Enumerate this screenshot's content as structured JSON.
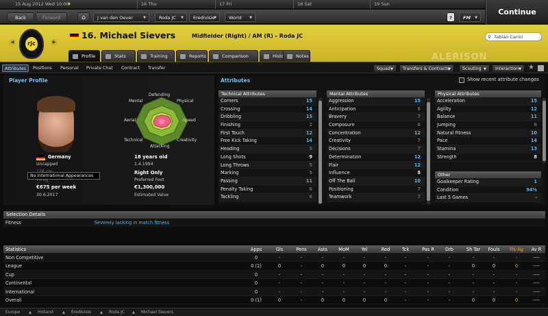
{
  "topbar": {
    "date": "15 Aug 2012 Wed 10:00",
    "days": [
      "16 Thu",
      "17 Fri",
      "18 Sat",
      "19 Sun"
    ]
  },
  "nav": {
    "back": "Back",
    "forward": "Forward",
    "manager": "J van den Oever",
    "club": "Roda JC",
    "league": "Eredivisie",
    "world": "World",
    "help": "?",
    "fm": "FM",
    "continue": "Continue"
  },
  "player": {
    "number_name": "16. Michael Sievers",
    "position_club": "Midfielder (Right) / AM (R) - Roda JC",
    "search_value": "fabián Carini",
    "crest_text": "rJc",
    "watermark": "ALERISON"
  },
  "player_tabs": [
    "Profile",
    "Stats",
    "Training",
    "Reports",
    "Comparison",
    "History",
    "Notes"
  ],
  "sub_tabs": [
    "Attributes",
    "Positions",
    "Personal",
    "Private Chat",
    "Contract",
    "Transfer"
  ],
  "sub_dropdowns": [
    "Squad",
    "Transfers & Contracts",
    "Scouting",
    "Interaction"
  ],
  "profile": {
    "title": "Player Profile",
    "nationality": "Germany",
    "caps": "Uncapped",
    "tooltip": "No International Appearances",
    "height": "178 cm",
    "weight": "76 kg",
    "wage": "€675 per week",
    "contract_end": "30.6.2017",
    "age": "18 years old",
    "dob": "1.4.1994",
    "foot": "Right Only",
    "foot_label": "Preferred Foot",
    "value": "€1,300,000",
    "value_label": "Estimated Value",
    "radar_labels": {
      "defending": "Defending",
      "physical": "Physical",
      "speed": "Speed",
      "creativity": "Creativity",
      "attacking": "Attacking",
      "technical": "Technical",
      "aerial": "Aerial",
      "mental": "Mental"
    }
  },
  "attributes": {
    "title": "Attributes",
    "show_recent": "Show recent attribute changes",
    "technical_title": "Technical Attributes",
    "technical": [
      [
        "Corners",
        "15"
      ],
      [
        "Crossing",
        "14"
      ],
      [
        "Dribbling",
        "15"
      ],
      [
        "Finishing",
        "2"
      ],
      [
        "First Touch",
        "12"
      ],
      [
        "Free Kick Taking",
        "14"
      ],
      [
        "Heading",
        "5"
      ],
      [
        "Long Shots",
        "9"
      ],
      [
        "Long Throws",
        "5"
      ],
      [
        "Marking",
        "5"
      ],
      [
        "Passing",
        "11"
      ],
      [
        "Penalty Taking",
        "6"
      ],
      [
        "Tackling",
        "6"
      ]
    ],
    "mental_title": "Mental Attributes",
    "mental": [
      [
        "Aggression",
        "15"
      ],
      [
        "Anticipation",
        "6"
      ],
      [
        "Bravery",
        "7"
      ],
      [
        "Composure",
        "6"
      ],
      [
        "Concentration",
        "12"
      ],
      [
        "Creativity",
        "7"
      ],
      [
        "Decisions",
        "7"
      ],
      [
        "Determination",
        "12"
      ],
      [
        "Flair",
        "12"
      ],
      [
        "Influence",
        "8"
      ],
      [
        "Off The Ball",
        "10"
      ],
      [
        "Positioning",
        "7"
      ],
      [
        "Teamwork",
        "7"
      ]
    ],
    "physical_title": "Physical Attributes",
    "physical": [
      [
        "Acceleration",
        "15"
      ],
      [
        "Agility",
        "12"
      ],
      [
        "Balance",
        "11"
      ],
      [
        "Jumping",
        "6"
      ],
      [
        "Natural Fitness",
        "10"
      ],
      [
        "Pace",
        "14"
      ],
      [
        "Stamina",
        "13"
      ],
      [
        "Strength",
        "8"
      ]
    ],
    "other_title": "Other",
    "other": [
      [
        "Goalkeeper Rating",
        "1"
      ],
      [
        "Condition",
        "94%"
      ],
      [
        "Last 5 Games",
        "-"
      ]
    ]
  },
  "selection": {
    "title": "Selection Details",
    "label": "Fitness",
    "value": "Severely lacking in match fitness"
  },
  "stats": {
    "columns": [
      "Statistics",
      "Apps",
      "Gls",
      "Pens",
      "Asts",
      "MoM",
      "Yel",
      "Red",
      "Tck",
      "Pas R",
      "Drb",
      "Sh Tar",
      "Fouls",
      "Fls Ag",
      "Av R"
    ],
    "rows": [
      [
        "Non Competitive",
        "0",
        "-",
        "-",
        "-",
        "-",
        "-",
        "-",
        "-",
        "-",
        "-",
        "-",
        "-",
        "-",
        "----"
      ],
      [
        "League",
        "0 (1)",
        "0",
        "-",
        "0",
        "0",
        "0",
        "0",
        "-",
        "-",
        "-",
        "0",
        "0",
        "0",
        "----"
      ],
      [
        "Cup",
        "0",
        "-",
        "-",
        "-",
        "-",
        "-",
        "-",
        "-",
        "-",
        "-",
        "-",
        "-",
        "-",
        "----"
      ],
      [
        "Continental",
        "0",
        "-",
        "-",
        "-",
        "-",
        "-",
        "-",
        "-",
        "-",
        "-",
        "-",
        "-",
        "-",
        "----"
      ],
      [
        "International",
        "0",
        "-",
        "-",
        "-",
        "-",
        "-",
        "-",
        "-",
        "-",
        "-",
        "-",
        "-",
        "-",
        "----"
      ],
      [
        "Overall",
        "0 (1)",
        "0",
        "-",
        "0",
        "0",
        "0",
        "0",
        "-",
        "-",
        "-",
        "0",
        "0",
        "0",
        "----"
      ]
    ]
  },
  "breadcrumb": [
    "Europe",
    "Holland",
    "Eredivisie",
    "Roda JC",
    "Michael Sievers"
  ],
  "colors": {
    "accent_blue": "#59b6ee",
    "header_yellow": "#d8c535",
    "fouls_against": "#f0a020"
  }
}
